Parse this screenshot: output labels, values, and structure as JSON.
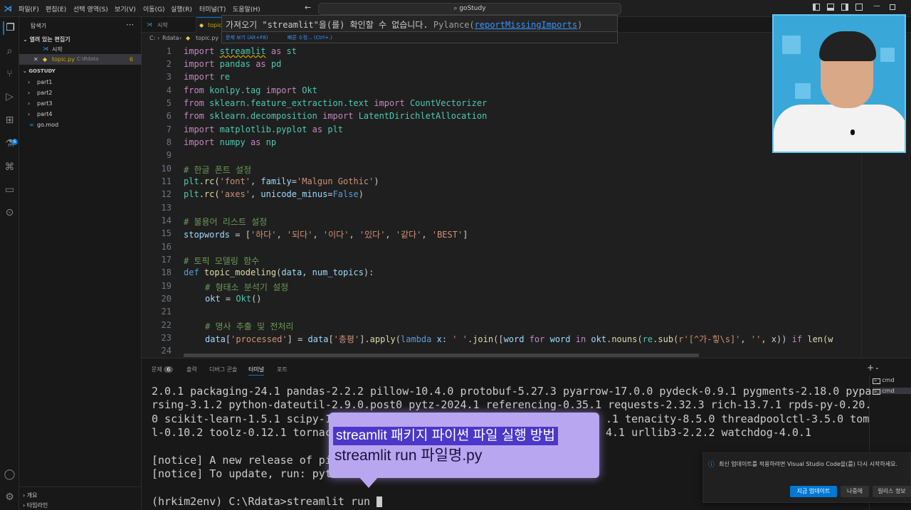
{
  "titlebar": {
    "menus": [
      "파일(F)",
      "편집(E)",
      "선택 영역(S)",
      "보기(V)",
      "이동(G)",
      "실행(R)",
      "터미널(T)",
      "도움말(H)"
    ],
    "search": "goStudy"
  },
  "sidebar": {
    "title": "탐색기",
    "open_editors_label": "열려 있는 편집기",
    "open_editors": [
      {
        "name": "시작",
        "path": ""
      },
      {
        "name": "topic.py",
        "path": "C:\\Rdata",
        "badge": "6"
      }
    ],
    "workspace_label": "GOSTUDY",
    "tree": [
      "part1",
      "part2",
      "part3",
      "part4",
      "go.mod"
    ],
    "outline_label": "개요",
    "timeline_label": "타임라인"
  },
  "editor": {
    "tabs": [
      "시작",
      "topic.py"
    ],
    "breadcrumb": [
      "C:",
      "Rdata",
      "topic.py"
    ],
    "hover": {
      "message_pre": "가져오기 \"streamlit\"을(를) 확인할 수 없습니다.",
      "source": "Pylance(",
      "link": "reportMissingImports",
      "source_end": ")",
      "action1": "문제 보기 (Alt+F8)",
      "action2": "빠른 수정... (Ctrl+.)"
    },
    "line_numbers": [
      "1",
      "2",
      "3",
      "4",
      "5",
      "6",
      "7",
      "8",
      "9",
      "10",
      "11",
      "12",
      "13",
      "14",
      "15",
      "16",
      "17",
      "18",
      "19",
      "20",
      "21",
      "22",
      "23",
      "24"
    ],
    "code": {
      "l1": [
        "import",
        "streamlit",
        "as",
        "st"
      ],
      "l2": [
        "import",
        "pandas",
        "as",
        "pd"
      ],
      "l3": [
        "import",
        "re"
      ],
      "l4": [
        "from",
        "konlpy.tag",
        "import",
        "Okt"
      ],
      "l5": [
        "from",
        "sklearn.feature_extraction.text",
        "import",
        "CountVectorizer"
      ],
      "l6": [
        "from",
        "sklearn.decomposition",
        "import",
        "LatentDirichletAllocation"
      ],
      "l7": [
        "import",
        "matplotlib.pyplot",
        "as",
        "plt"
      ],
      "l8": [
        "import",
        "numpy",
        "as",
        "np"
      ],
      "l10": "# 한글 폰트 설정",
      "l11": [
        "plt",
        ".rc(",
        "'font'",
        ", ",
        "family",
        "=",
        "'Malgun Gothic'",
        ")"
      ],
      "l12": [
        "plt",
        ".rc(",
        "'axes'",
        ", ",
        "unicode_minus",
        "=",
        "False",
        ")"
      ],
      "l14": "# 불용어 리스트 설정",
      "l15": [
        "stopwords",
        " = [",
        "'하다'",
        ", ",
        "'되다'",
        ", ",
        "'이다'",
        ", ",
        "'있다'",
        ", ",
        "'같다'",
        ", ",
        "'BEST'",
        "]"
      ],
      "l17": "# 토픽 모델링 함수",
      "l18": [
        "def",
        "topic_modeling",
        "(",
        "data",
        ", ",
        "num_topics",
        "):"
      ],
      "l19": "# 형태소 분석기 설정",
      "l20": [
        "okt",
        " = ",
        "Okt",
        "()"
      ],
      "l22": "# 명사 추출 및 전처리",
      "l23": [
        "data",
        "[",
        "'processed'",
        "] = ",
        "data",
        "[",
        "'총평'",
        "].",
        "apply",
        "(",
        "lambda",
        " x: ",
        "' '",
        ".",
        "join",
        "([",
        "word",
        " for ",
        "word",
        " in ",
        "okt",
        ".",
        "nouns",
        "(",
        "re",
        ".",
        "sub",
        "(",
        "r'[^가-힣\\s]'",
        ", ",
        "''",
        ", x)) ",
        "if",
        " len(w"
      ]
    }
  },
  "panel": {
    "tabs": [
      "문제",
      "출력",
      "디버그 콘솔",
      "터미널",
      "포트"
    ],
    "problems_badge": "6",
    "active_tab": "터미널",
    "terminals": [
      "cmd",
      "cmd"
    ],
    "lines": [
      "2.0.1 packaging-24.1 pandas-2.2.2 pillow-10.4.0 protobuf-5.27.3 pyarrow-17.0.0 pydeck-0.9.1 pygments-2.18.0 pypa",
      "rsing-3.1.2 python-dateutil-2.9.0.post0 pytz-2024.1 referencing-0.35.1 requests-2.32.3 rich-13.7.1 rpds-py-0.20.",
      "0 scikit-learn-1.5.1 scipy-1",
      "l-0.10.2 toolz-0.12.1 tornac",
      "",
      "[notice] A new release of pi",
      "[notice] To update, run: pyt",
      "",
      "(hrkim2env) C:\\Rdata>streamlit run "
    ],
    "line3_tail": ".1 tenacity-8.5.0 threadpoolctl-3.5.0 tom",
    "line4_tail": "4.1 urllib3-2.2.2 watchdog-4.0.1"
  },
  "caption": {
    "line1": "streamlit 패키지 파이썬 파일 실행 방법",
    "line2": "streamlit run 파일명.py"
  },
  "notification": {
    "message": "최신 업데이트를 적용하려면 Visual Studio Code을(를) 다시 시작하세요.",
    "buttons": [
      "지금 업데이트",
      "나중에",
      "릴리스 정보"
    ]
  },
  "colors": {
    "accent": "#0078d4",
    "caption_bg": "#b9a6f0",
    "caption_highlight": "#4b37c8"
  }
}
